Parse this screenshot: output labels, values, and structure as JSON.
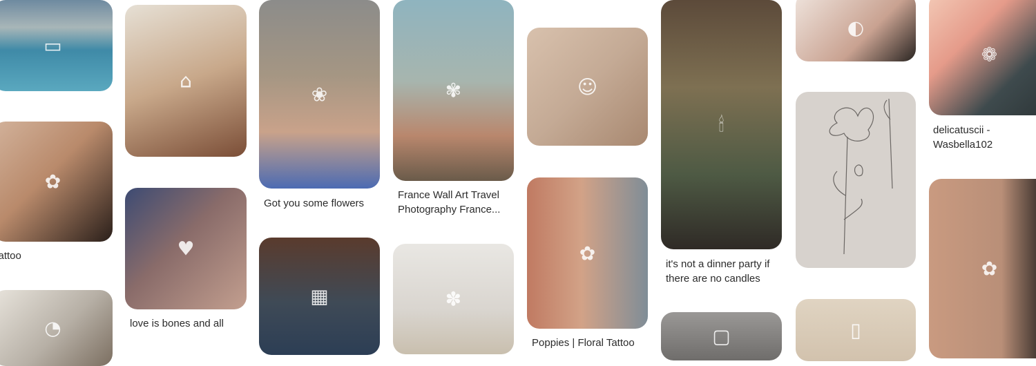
{
  "pins": [
    {
      "caption": "",
      "icon": "book-image-icon",
      "bg": "#4e8fa6"
    },
    {
      "caption": "Tattoo",
      "icon": "tattoo-image-icon",
      "bg": "#b9836a"
    },
    {
      "caption": "",
      "icon": "cat-image-icon",
      "bg": "#b7b0a6"
    },
    {
      "caption": "",
      "icon": "room-image-icon",
      "bg": "#b0896c"
    },
    {
      "caption": "love is bones and all",
      "icon": "couple-image-icon",
      "bg": "#8a6c6a"
    },
    {
      "caption": "Got you some flowers",
      "icon": "flower-image-icon",
      "bg": "#9d8f7a"
    },
    {
      "caption": "",
      "icon": "street-image-icon",
      "bg": "#3f4a56"
    },
    {
      "caption": "France Wall Art Travel Photography France...",
      "icon": "door-flowers-image-icon",
      "bg": "#8aa3a3"
    },
    {
      "caption": "",
      "icon": "daisy-bag-image-icon",
      "bg": "#d9d5cf"
    },
    {
      "caption": "",
      "icon": "face-image-icon",
      "bg": "#c4aa95"
    },
    {
      "caption": "Poppies | Floral Tattoo",
      "icon": "arm-tattoo-image-icon",
      "bg": "#9c7c6a"
    },
    {
      "caption": "it's not a dinner party if there are no candles",
      "icon": "candles-image-icon",
      "bg": "#7e7052"
    },
    {
      "caption": "",
      "icon": "room-dark-image-icon",
      "bg": "#8a8886"
    },
    {
      "caption": "",
      "icon": "neck-image-icon",
      "bg": "#c9a291"
    },
    {
      "caption": "",
      "icon": "sketch-image-icon",
      "bg": "#d7d2cd"
    },
    {
      "caption": "",
      "icon": "door-image-icon",
      "bg": "#d2c2ad"
    },
    {
      "caption": "delicatuscii - Wasbella102",
      "icon": "peony-image-icon",
      "bg": "#3e4a4d"
    },
    {
      "caption": "",
      "icon": "poppy-tattoo-image-icon",
      "bg": "#b98f78"
    }
  ]
}
